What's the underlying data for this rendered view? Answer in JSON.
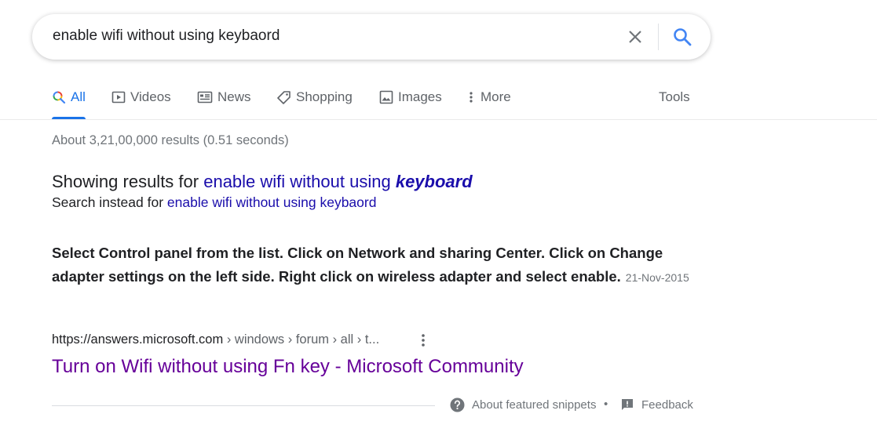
{
  "search": {
    "query": "enable wifi without using keybaord"
  },
  "tabs": [
    {
      "label": "All",
      "icon": "search-multicolor-icon",
      "active": true
    },
    {
      "label": "Videos",
      "icon": "play-icon"
    },
    {
      "label": "News",
      "icon": "newspaper-icon"
    },
    {
      "label": "Shopping",
      "icon": "tag-icon"
    },
    {
      "label": "Images",
      "icon": "image-icon"
    },
    {
      "label": "More",
      "icon": "more-vert-icon"
    }
  ],
  "tools_label": "Tools",
  "stats": "About 3,21,00,000 results (0.51 seconds)",
  "correction": {
    "prefix": "Showing results for",
    "corrected_plain": "enable wifi without using",
    "corrected_bold": "keyboard",
    "instead_prefix": "Search instead for",
    "original": "enable wifi without using keybaord"
  },
  "snippet": {
    "text": "Select Control panel from the list. Click on Network and sharing Center. Click on Change adapter settings on the left side. Right click on wireless adapter and select enable.",
    "date": "21-Nov-2015"
  },
  "result": {
    "domain": "https://answers.microsoft.com",
    "path": " › windows › forum › all › t...",
    "title": "Turn on Wifi without using Fn key - Microsoft Community"
  },
  "footer": {
    "about": "About featured snippets",
    "separator": "•",
    "feedback": "Feedback"
  },
  "colors": {
    "accent": "#1a73e8",
    "link": "#1a0dab",
    "visited": "#660099"
  }
}
